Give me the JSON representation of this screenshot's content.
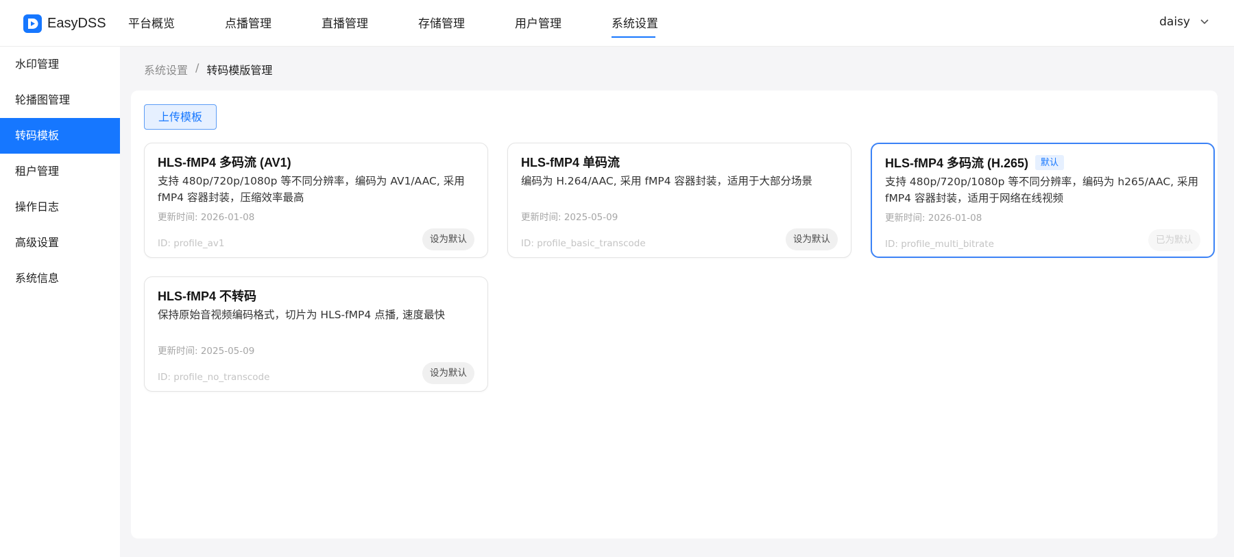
{
  "brand": {
    "name": "EasyDSS",
    "color": "#1677ff"
  },
  "nav": [
    {
      "label": "平台概览"
    },
    {
      "label": "点播管理"
    },
    {
      "label": "直播管理"
    },
    {
      "label": "存储管理"
    },
    {
      "label": "用户管理"
    },
    {
      "label": "系统设置",
      "active": true
    }
  ],
  "user": {
    "name": "daisy"
  },
  "sidebar": [
    {
      "label": "水印管理"
    },
    {
      "label": "轮播图管理"
    },
    {
      "label": "转码模板",
      "active": true
    },
    {
      "label": "租户管理"
    },
    {
      "label": "操作日志"
    },
    {
      "label": "高级设置"
    },
    {
      "label": "系统信息"
    }
  ],
  "breadcrumb": {
    "parent": "系统设置",
    "separator": "/",
    "current": "转码模版管理"
  },
  "upload_button": "上传模板",
  "cards": [
    {
      "title": "HLS-fMP4 多码流 (AV1)",
      "badge": "",
      "description": "支持 480p/720p/1080p 等不同分辨率，编码为 AV1/AAC, 采用 fMP4 容器封装，压缩效率最高",
      "updated": "更新时间: 2026-01-08",
      "id": "ID: profile_av1",
      "button": "设为默认"
    },
    {
      "title": "HLS-fMP4 单码流",
      "badge": "",
      "description": "编码为 H.264/AAC, 采用 fMP4 容器封装，适用于大部分场景",
      "updated": "更新时间: 2025-05-09",
      "id": "ID: profile_basic_transcode",
      "button": "设为默认"
    },
    {
      "title": "HLS-fMP4 多码流 (H.265)",
      "badge": "默认",
      "description": "支持 480p/720p/1080p 等不同分辨率，编码为 h265/AAC, 采用 fMP4 容器封装，适用于网络在线视频",
      "updated": "更新时间: 2026-01-08",
      "id": "ID: profile_multi_bitrate",
      "button": "已为默认",
      "selected": true
    },
    {
      "title": "HLS-fMP4 不转码",
      "badge": "",
      "description": "保持原始音视频编码格式，切片为 HLS-fMP4 点播, 速度最快",
      "updated": "更新时间: 2025-05-09",
      "id": "ID: profile_no_transcode",
      "button": "设为默认"
    }
  ]
}
